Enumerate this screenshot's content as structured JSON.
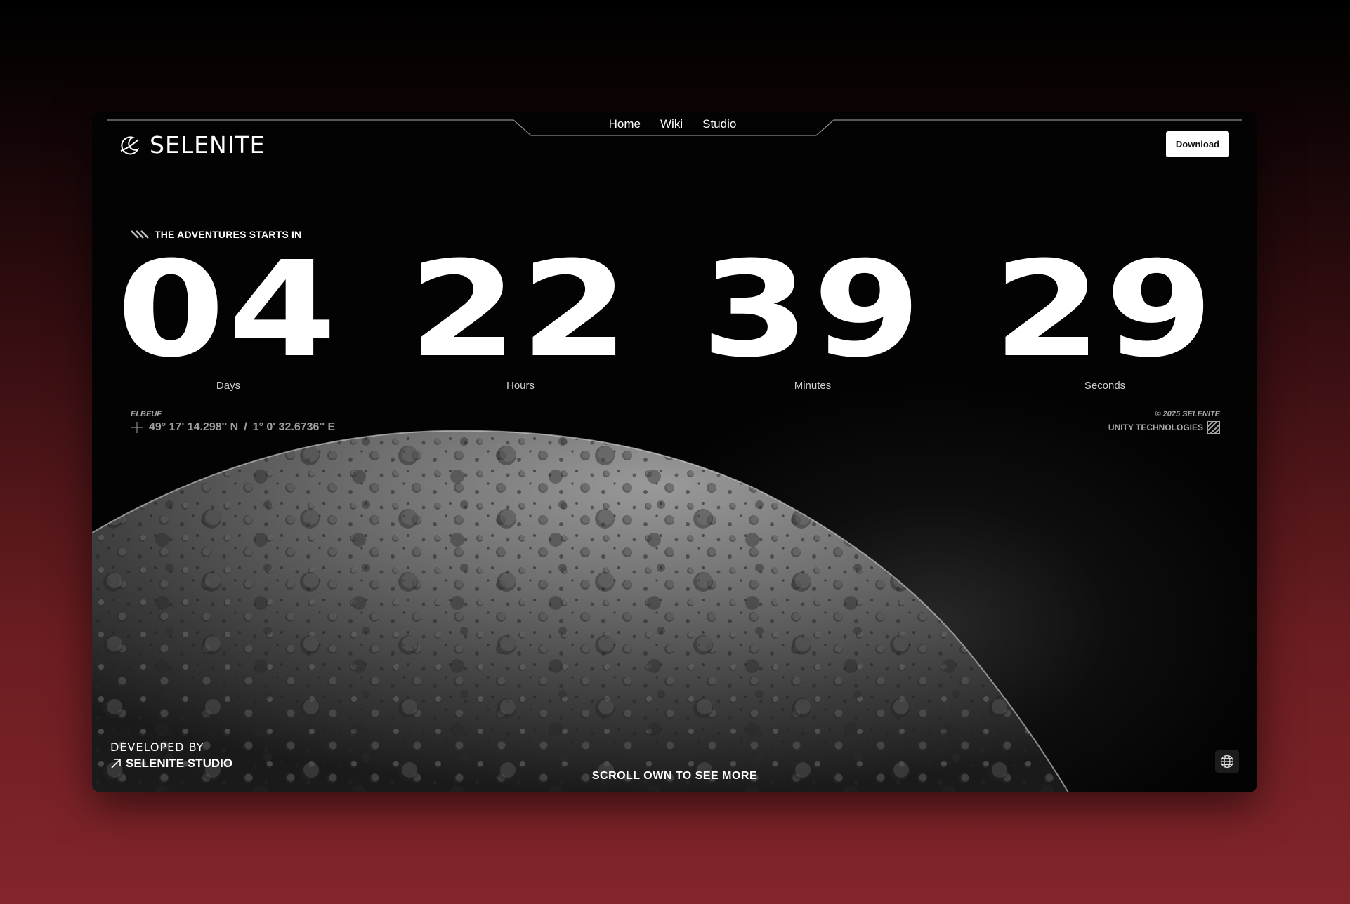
{
  "brand": {
    "name": "SELENITE",
    "logo_icon": "crescent-moon-icon"
  },
  "nav": {
    "items": [
      {
        "label": "Home"
      },
      {
        "label": "Wiki"
      },
      {
        "label": "Studio"
      }
    ]
  },
  "header": {
    "download_label": "Download"
  },
  "countdown": {
    "tagline": "THE ADVENTURES STARTS IN",
    "tagline_icon": "double-slash-icon",
    "days": {
      "value": "04",
      "label": "Days"
    },
    "hours": {
      "value": "22",
      "label": "Hours"
    },
    "minutes": {
      "value": "39",
      "label": "Minutes"
    },
    "seconds": {
      "value": "29",
      "label": "Seconds"
    }
  },
  "location": {
    "city": "ELBEUF",
    "latitude": "49° 17' 14.298'' N",
    "separator": "/",
    "longitude": "1° 0' 32.6736'' E",
    "icon": "crosshair-icon"
  },
  "copyright": {
    "line1": "© 2025 SELENITE",
    "line2": "UNITY TECHNOLOGIES",
    "icon": "striped-square-icon"
  },
  "footer": {
    "developed_by": "DEVELOPED BY",
    "studio": "SELENITE STUDIO",
    "studio_icon": "arrow-up-right-icon",
    "scroll_hint": "SCROLL OWN TO SEE MORE",
    "language_icon": "globe-icon"
  },
  "colors": {
    "background_top": "#000000",
    "background_bottom": "#83252a",
    "panel": "#030303",
    "text": "#ffffff",
    "muted": "#a8a8a8"
  }
}
